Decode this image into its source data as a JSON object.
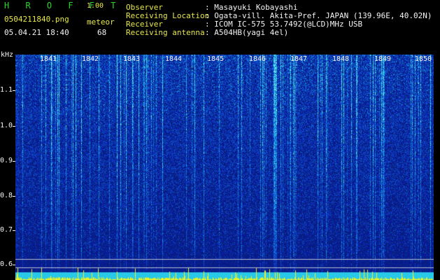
{
  "app": {
    "name": "H R O F F T",
    "version": "1.00",
    "filename": "0504211840.png",
    "datetime": "05.04.21 18:40",
    "counter_label": "meteor",
    "counter_value": "68"
  },
  "info": {
    "rows": [
      {
        "label": "Observer",
        "value": ": Masayuki Kobayashi"
      },
      {
        "label": "Receiving Location",
        "value": ": Ogata-vill. Akita-Pref. JAPAN (139.96E, 40.02N)"
      },
      {
        "label": "Receiver",
        "value": ": ICOM IC-575 53.7492(@LCD)MHz USB"
      },
      {
        "label": "Receiving antenna",
        "value": ": A504HB(yagi 4el)"
      }
    ]
  },
  "axis": {
    "y_unit": "kHz",
    "y_ticks": [
      "1.1",
      "1.0",
      "0.9",
      "0.8",
      "0.7",
      "0.6"
    ],
    "x_ticks": [
      "1841",
      "1842",
      "1843",
      "1844",
      "1845",
      "1846",
      "1847",
      "1848",
      "1849",
      "1850"
    ]
  },
  "colors": {
    "background": "#000000",
    "header_green": "#2bd62b",
    "header_yellow": "#e8e84a",
    "text_white": "#f4f4f4",
    "spectrum_dark": "#0a1a8a",
    "spectrum_mid": "#1e56d8",
    "spectrum_hot": "#38d8f0",
    "signal_yellow": "#f0f020"
  }
}
